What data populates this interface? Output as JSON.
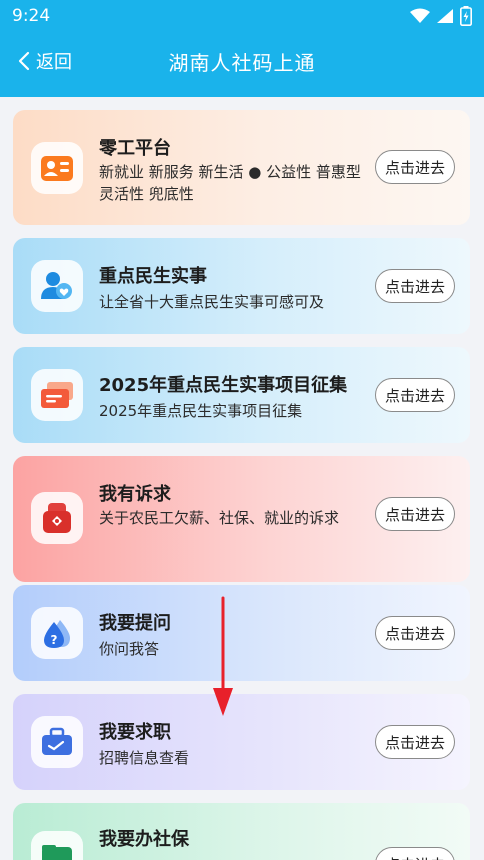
{
  "status_bar": {
    "time": "9:24"
  },
  "header": {
    "back_label": "返回",
    "title": "湖南人社码上通"
  },
  "cards": [
    {
      "title": "零工平台",
      "desc": "新就业 新服务 新生活 ● 公益性 普惠型 灵活性 兜底性",
      "button": "点击进去",
      "icon": "id-card-icon"
    },
    {
      "title": "重点民生实事",
      "desc": "让全省十大重点民生实事可感可及",
      "button": "点击进去",
      "icon": "people-heart-icon"
    },
    {
      "title": "2025年重点民生实事项目征集",
      "desc": "2025年重点民生实事项目征集",
      "button": "点击进去",
      "icon": "cards-icon"
    },
    {
      "title": "我有诉求",
      "desc": "关于农民工欠薪、社保、就业的诉求",
      "button": "点击进去",
      "icon": "mailbox-icon"
    },
    {
      "title": "我要提问",
      "desc": "你问我答",
      "button": "点击进去",
      "icon": "question-drop-icon"
    },
    {
      "title": "我要求职",
      "desc": "招聘信息查看",
      "button": "点击进去",
      "icon": "briefcase-icon"
    },
    {
      "title": "我要办社保",
      "desc": "",
      "button": "点击进去",
      "icon": "folder-icon"
    }
  ],
  "colors": {
    "header_bg": "#1ab3eb",
    "arrow": "#e8202a"
  }
}
